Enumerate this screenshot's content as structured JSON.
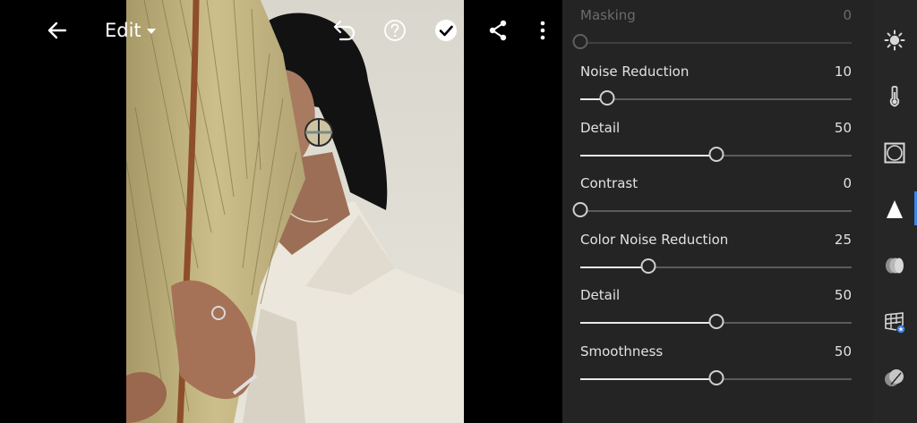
{
  "toolbar": {
    "edit_label": "Edit"
  },
  "panel": {
    "rows": [
      {
        "label": "Masking",
        "value": "0",
        "level": 0,
        "disabled": true
      },
      {
        "label": "Noise Reduction",
        "value": "10",
        "level": 10
      },
      {
        "label": "Detail",
        "value": "50",
        "level": 50
      },
      {
        "label": "Contrast",
        "value": "0",
        "level": 0
      },
      {
        "label": "Color Noise Reduction",
        "value": "25",
        "level": 25
      },
      {
        "label": "Detail",
        "value": "50",
        "level": 50
      },
      {
        "label": "Smoothness",
        "value": "50",
        "level": 50
      }
    ]
  },
  "rail": {
    "tools": [
      "light-icon",
      "color-temperature-icon",
      "effects-icon",
      "detail-icon",
      "optics-icon",
      "geometry-icon",
      "presets-icon"
    ],
    "active_tool": "detail-icon",
    "accent": "#3c83e6"
  }
}
